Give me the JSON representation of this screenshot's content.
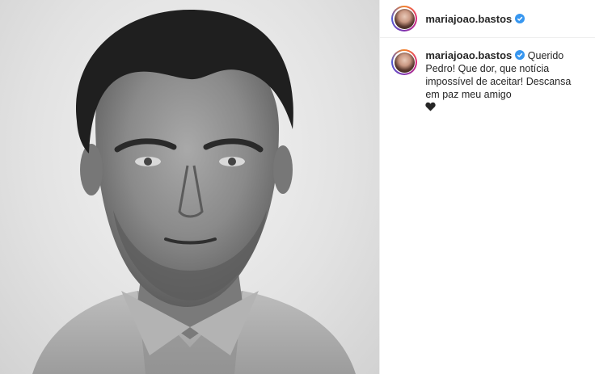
{
  "post": {
    "username": "mariajoao.bastos",
    "verified_icon": "verified-badge-icon",
    "caption": "Querido Pedro! Que dor, que notícia impossível de aceitar! Descansa em paz meu amigo",
    "caption_emoji": "black-heart-icon",
    "accent_color": "#3897f0",
    "photo_subject": "black and white portrait"
  }
}
